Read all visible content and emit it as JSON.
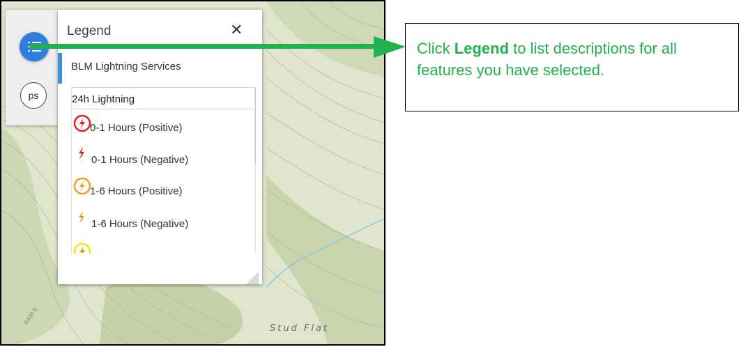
{
  "map": {
    "place_label": "Stud Flat",
    "elevation_label": "6400 ft",
    "colors": {
      "terrain": "#dfe6cd",
      "forest": "#c9d5b0",
      "river": "#7ec3d6"
    }
  },
  "toolbar": {
    "legend_button_icon": "list-icon",
    "ps_button_label": "ps"
  },
  "legend": {
    "title": "Legend",
    "close_icon": "close-icon",
    "layer_name": "BLM Lightning Services",
    "group_title": "24h Lightning",
    "items": [
      {
        "label": "0-1 Hours (Positive)",
        "icon": "lightning-positive-icon",
        "color": "#e41e1e"
      },
      {
        "label": "0-1 Hours (Negative)",
        "icon": "lightning-negative-icon",
        "color": "#e41e1e"
      },
      {
        "label": "1-6 Hours (Positive)",
        "icon": "lightning-positive-icon",
        "color": "#f0a020"
      },
      {
        "label": "1-6 Hours (Negative)",
        "icon": "lightning-negative-icon",
        "color": "#e69a1a"
      },
      {
        "label": "",
        "icon": "lightning-positive-icon",
        "color": "#f2e60f"
      }
    ]
  },
  "callout": {
    "prefix": "Click ",
    "bold": "Legend",
    "suffix": " to list descriptions for all features you have selected.",
    "color": "#22b14c"
  }
}
